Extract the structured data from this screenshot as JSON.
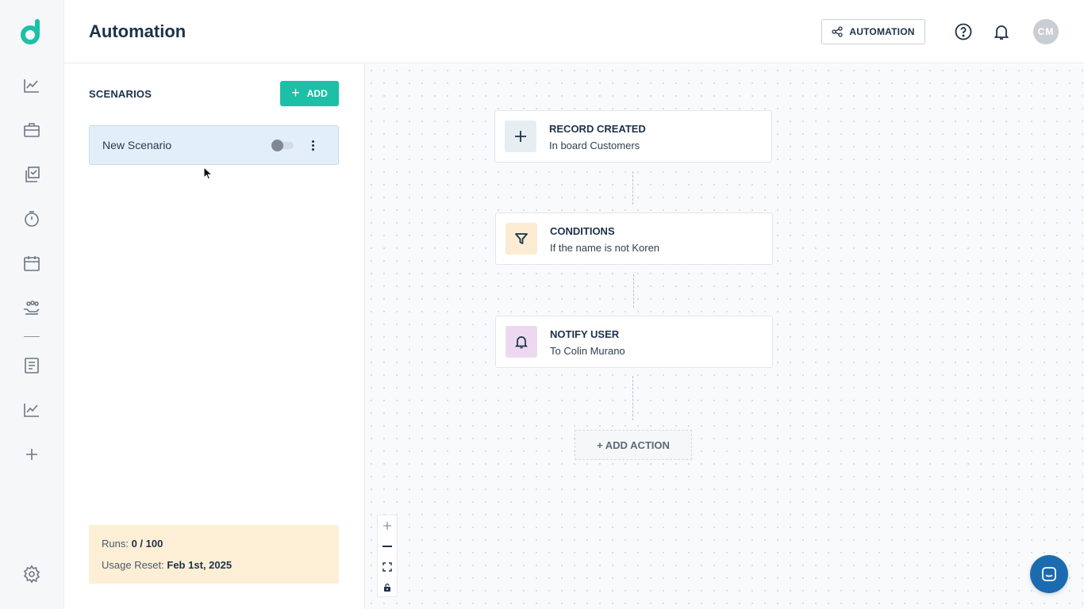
{
  "header": {
    "title": "Automation",
    "automation_button": "AUTOMATION",
    "avatar_initials": "CM"
  },
  "sidebar": {
    "icons": [
      "logo-icon",
      "analytics-icon",
      "briefcase-icon",
      "tasks-icon",
      "timer-icon",
      "calendar-icon",
      "team-icon",
      "document-icon",
      "chart-icon",
      "add-icon",
      "settings-icon"
    ]
  },
  "scenarios": {
    "title": "SCENARIOS",
    "add_label": "ADD",
    "items": [
      {
        "name": "New Scenario",
        "enabled": false
      }
    ],
    "usage": {
      "runs_label": "Runs:",
      "runs_value": "0 / 100",
      "reset_label": "Usage Reset:",
      "reset_value": "Feb 1st, 2025"
    }
  },
  "flow": {
    "nodes": [
      {
        "title": "RECORD CREATED",
        "subtitle": "In board Customers",
        "icon": "plus-icon",
        "color": "#e6eef2"
      },
      {
        "title": "CONDITIONS",
        "subtitle": "If the name is not Koren",
        "icon": "filter-icon",
        "color": "#fbecd3"
      },
      {
        "title": "NOTIFY USER",
        "subtitle": "To Colin Murano",
        "icon": "bell-icon",
        "color": "#ecd9ef"
      }
    ],
    "add_action": "+ ADD ACTION"
  },
  "colors": {
    "accent": "#1cc0a6",
    "brand_dark": "#1d3149",
    "chat": "#1c6bb0"
  }
}
